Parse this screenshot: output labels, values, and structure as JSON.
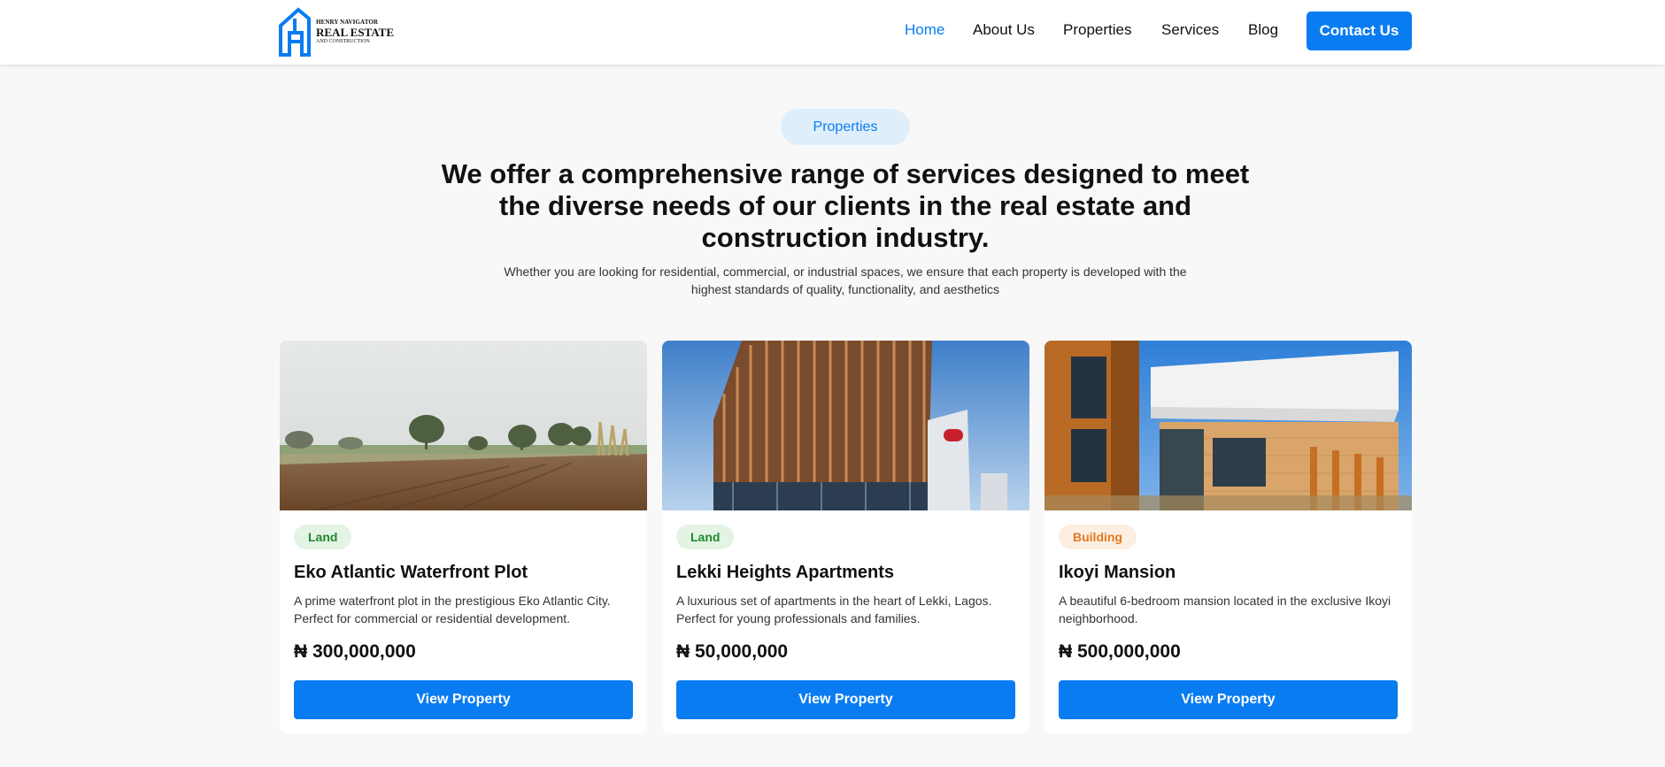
{
  "brand": {
    "line1": "HENRY NAVIGATOR",
    "line2": "REAL ESTATE",
    "line3": "AND CONSTRUCTION"
  },
  "nav": {
    "items": [
      {
        "label": "Home",
        "active": true
      },
      {
        "label": "About Us"
      },
      {
        "label": "Properties"
      },
      {
        "label": "Services"
      },
      {
        "label": "Blog"
      }
    ],
    "cta": "Contact Us"
  },
  "intro": {
    "pill": "Properties",
    "headline": "We offer a comprehensive range of services designed to meet the diverse needs of our clients in the real estate and construction industry.",
    "subtext": "Whether you are looking for residential, commercial, or industrial spaces, we ensure that each property is developed with the highest standards of quality, functionality, and aesthetics"
  },
  "properties": [
    {
      "category": "Land",
      "title": "Eko Atlantic Waterfront Plot",
      "description": "A prime waterfront plot in the prestigious Eko Atlantic City. Perfect for commercial or residential development.",
      "price": "₦ 300,000,000",
      "button": "View Property"
    },
    {
      "category": "Land",
      "title": "Lekki Heights Apartments",
      "description": "A luxurious set of apartments in the heart of Lekki, Lagos. Perfect for young professionals and families.",
      "price": "₦ 50,000,000",
      "button": "View Property"
    },
    {
      "category": "Building",
      "title": "Ikoyi Mansion",
      "description": "A beautiful 6-bedroom mansion located in the exclusive Ikoyi neighborhood.",
      "price": "₦ 500,000,000",
      "button": "View Property"
    }
  ],
  "colors": {
    "accent": "#0a7cf2",
    "land_badge_bg": "#e4f4e4",
    "land_badge_text": "#1f8a2e",
    "building_badge_bg": "#fdeee2",
    "building_badge_text": "#e07a1f"
  }
}
